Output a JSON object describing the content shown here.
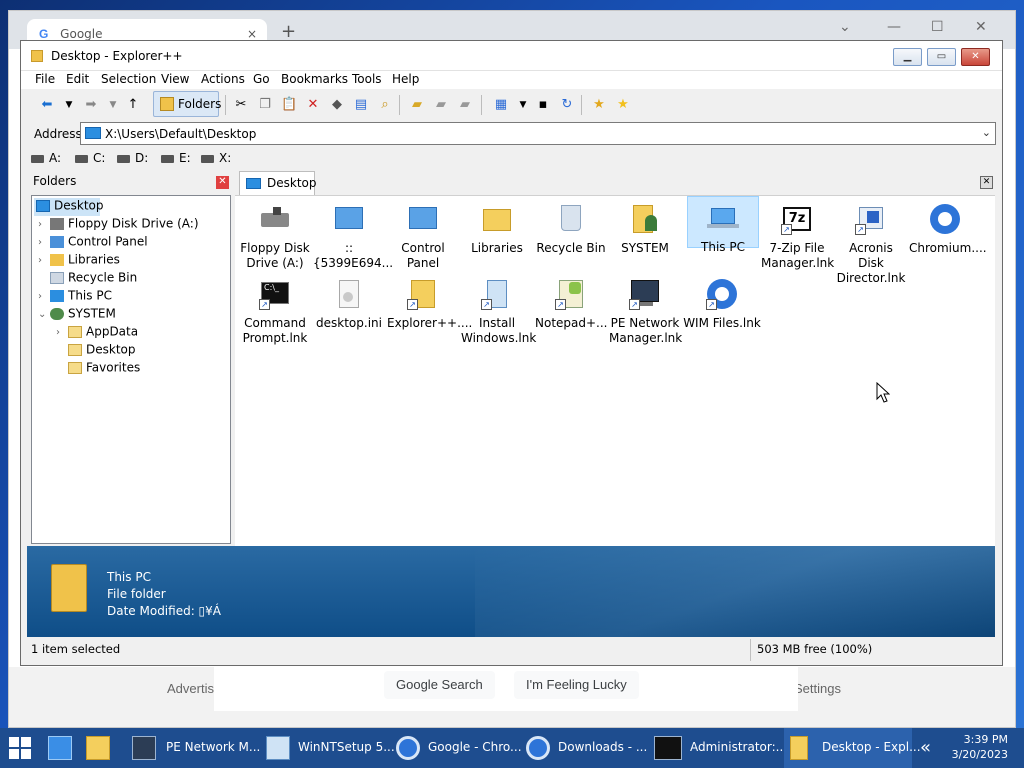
{
  "chrome": {
    "tab_title": "Google",
    "tab_close": "×",
    "new_tab": "+",
    "minimize": "—",
    "maximize": "☐",
    "close": "✕",
    "advertising": "Advertis",
    "settings": "Settings",
    "google_search": "Google Search",
    "feeling_lucky": "I'm Feeling Lucky"
  },
  "explorer": {
    "title": "Desktop - Explorer++",
    "menu": [
      "File",
      "Edit",
      "Selection",
      "View",
      "Actions",
      "Go",
      "Bookmarks",
      "Tools",
      "Help"
    ],
    "folders_button": "Folders",
    "address_label": "Address",
    "address_value": "X:\\Users\\Default\\Desktop",
    "drives": [
      "A:",
      "C:",
      "D:",
      "E:",
      "X:"
    ],
    "folders_title": "Folders",
    "tree": [
      "Desktop",
      "Floppy Disk Drive (A:)",
      "Control Panel",
      "Libraries",
      "Recycle Bin",
      "This PC",
      "SYSTEM",
      "AppData",
      "Desktop",
      "Favorites"
    ],
    "tab_label": "Desktop",
    "files": [
      {
        "line1": "Floppy Disk",
        "line2": "Drive (A:)"
      },
      {
        "line1": "::{5399E694...",
        "line2": ""
      },
      {
        "line1": "Control Panel",
        "line2": ""
      },
      {
        "line1": "Libraries",
        "line2": ""
      },
      {
        "line1": "Recycle Bin",
        "line2": ""
      },
      {
        "line1": "SYSTEM",
        "line2": ""
      },
      {
        "line1": "This PC",
        "line2": ""
      },
      {
        "line1": "7-Zip File",
        "line2": "Manager.lnk"
      },
      {
        "line1": "Acronis Disk",
        "line2": "Director.lnk"
      },
      {
        "line1": "Chromium....",
        "line2": ""
      },
      {
        "line1": "Command",
        "line2": "Prompt.lnk"
      },
      {
        "line1": "desktop.ini",
        "line2": ""
      },
      {
        "line1": "Explorer++....",
        "line2": ""
      },
      {
        "line1": "Install",
        "line2": "Windows.lnk"
      },
      {
        "line1": "Notepad+...",
        "line2": ""
      },
      {
        "line1": "PE Network",
        "line2": "Manager.lnk"
      },
      {
        "line1": "WIM Files.lnk",
        "line2": ""
      }
    ],
    "preview": {
      "name": "This PC",
      "type": "File folder",
      "modified": "Date Modified: ▯¥Á"
    },
    "status_left": "1 item selected",
    "status_right": "503 MB free (100%)"
  },
  "taskbar": {
    "items": [
      "PE Network M...",
      "WinNTSetup 5...",
      "Google - Chro...",
      "Downloads - ...",
      "Administrator:...",
      "Desktop - Expl..."
    ],
    "overflow": "«",
    "time": "3:39 PM",
    "date": "3/20/2023"
  },
  "colors": {
    "selection": "#cce8ff",
    "taskbar": "#1e4d8f",
    "preview": "#1a5a94"
  }
}
